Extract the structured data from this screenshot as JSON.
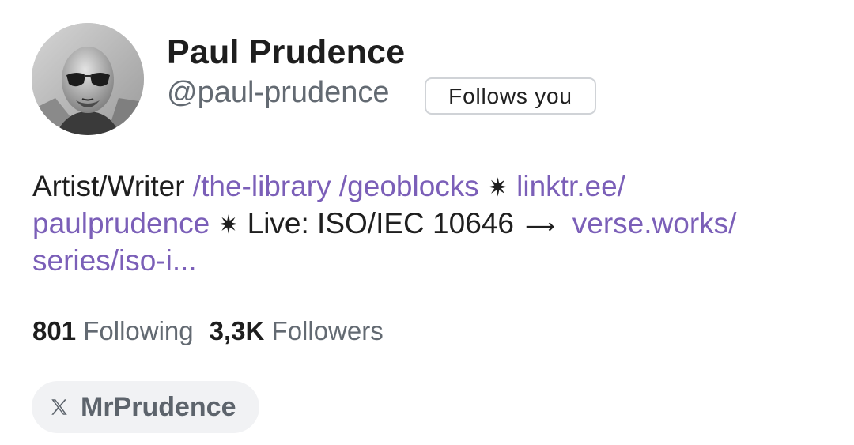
{
  "profile": {
    "name": "Paul Prudence",
    "handle": "@paul-prudence",
    "follows_badge": "Follows you"
  },
  "bio": {
    "line1": {
      "text1": "Artist/Writer ",
      "link1": "/the-library",
      "link2": "/geoblocks",
      "star": "✷",
      "link3": "linktr.ee/"
    },
    "line2": {
      "link1": "paulprudence",
      "star": "✷",
      "text1": " Live: ISO/IEC 10646 ",
      "arrow": "⟶",
      "link2": "verse.works/"
    },
    "line3": {
      "link1": "series/iso-i..."
    }
  },
  "stats": {
    "following_count": "801",
    "following_label": "Following",
    "followers_count": "3,3K",
    "followers_label": "Followers"
  },
  "social": {
    "icon": "x-logo-icon",
    "label": "MrPrudence"
  },
  "colors": {
    "link": "#7b5fb8",
    "muted": "#636a72",
    "text": "#1f1f1f",
    "chip_bg": "#f1f2f4"
  }
}
